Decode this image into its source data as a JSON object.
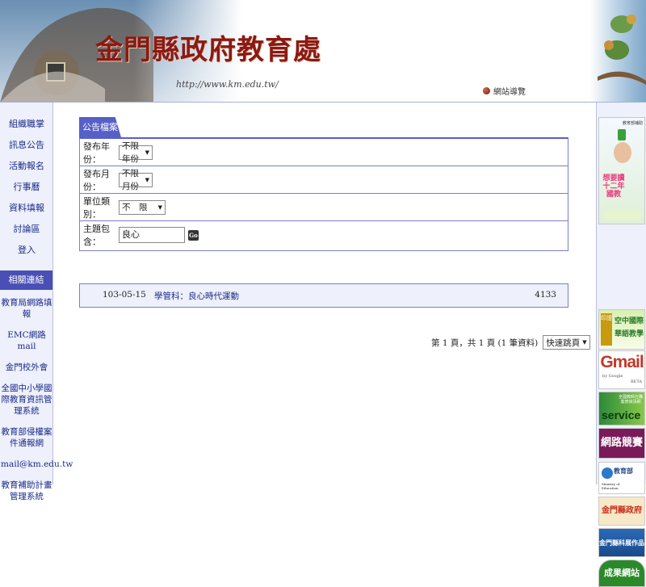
{
  "header": {
    "title": "金門縣政府教育處",
    "url": "http://www.km.edu.tw/",
    "sitemap_label": "網站導覽"
  },
  "nav": {
    "main": [
      "組織職掌",
      "訊息公告",
      "活動報名",
      "行事曆",
      "資料填報",
      "討論區",
      "登入"
    ],
    "related_header": "相關連結",
    "links": [
      "教育局網路填報",
      "EMC網路mail",
      "金門校外會",
      "全國中小學國際教育資訊管理系統",
      "教育部侵權案件通報網",
      "mail@km.edu.tw",
      "教育補助計畫管理系統"
    ]
  },
  "panel": {
    "tab": "公告檔案",
    "year_label": "發布年份：",
    "year_value": "不限年份",
    "month_label": "發布月份：",
    "month_value": "不限月份",
    "unit_label": "單位類別：",
    "unit_value": "不　限",
    "keyword_label": "主題包含：",
    "keyword_value": "良心",
    "go_label": "Go"
  },
  "results": [
    {
      "date": "103-05-15",
      "title": "學管科：良心時代運動",
      "count": "4133"
    }
  ],
  "pager": {
    "summary": "第 1 頁，共 1 頁 (1 筆資料)",
    "quick_label": "快速跳頁"
  },
  "right_banners": {
    "b1": "教育部補助",
    "b1_slogan": "想要讀十二年國教",
    "b2": "空中國際華語教學",
    "b3": "Gmail",
    "b3_sub": "by Google",
    "b3_tag": "BETA",
    "b4": "全國教師在職進修資訊網",
    "b4_sub": "service",
    "b5": "網路競賽",
    "b6": "教育部",
    "b6_sub": "Ministry of Education",
    "b7": "金門縣政府",
    "b8": "金門縣科展作品",
    "b9": "成果網站"
  }
}
